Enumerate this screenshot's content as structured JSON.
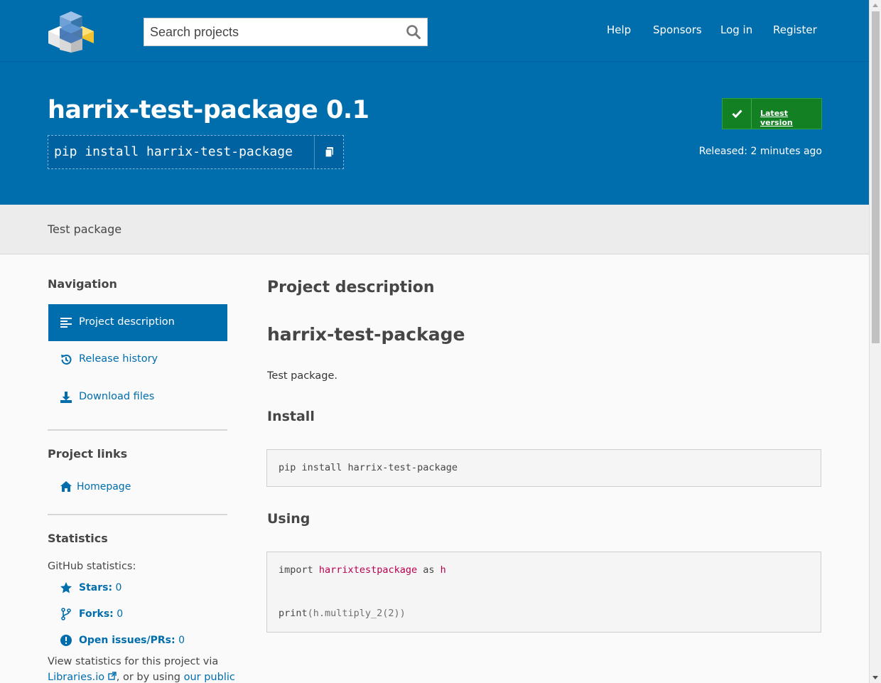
{
  "header": {
    "search_placeholder": "Search projects",
    "nav": [
      "Help",
      "Sponsors",
      "Log in",
      "Register"
    ]
  },
  "banner": {
    "title": "harrix-test-package 0.1",
    "pip_command": "pip install harrix-test-package",
    "latest_version_label": "Latest version",
    "released_label": "Released:",
    "released_value": "2 minutes ago"
  },
  "summary": "Test package",
  "sidebar": {
    "navigation_heading": "Navigation",
    "nav_items": [
      {
        "label": "Project description",
        "icon": "align-left-icon",
        "active": true
      },
      {
        "label": "Release history",
        "icon": "history-icon",
        "active": false
      },
      {
        "label": "Download files",
        "icon": "download-icon",
        "active": false
      }
    ],
    "links_heading": "Project links",
    "homepage_label": "Homepage",
    "statistics_heading": "Statistics",
    "github_stats_label": "GitHub statistics:",
    "stars_label": "Stars:",
    "stars_value": "0",
    "forks_label": "Forks:",
    "forks_value": "0",
    "issues_label": "Open issues/PRs:",
    "issues_value": "0",
    "view_stats_text": "View statistics for this project via",
    "libraries_link": "Libraries.io",
    "or_text": ", or by using",
    "our_public_link": "our public"
  },
  "main": {
    "section_heading": "Project description",
    "readme_title": "harrix-test-package",
    "readme_text": "Test package.",
    "install_heading": "Install",
    "install_code": "pip install harrix-test-package",
    "using_heading": "Using",
    "code_line1": {
      "kw": "import",
      "name": "harrixtestpackage",
      "as": "as",
      "alias": "h"
    },
    "code_line2": {
      "fn": "print",
      "rest": "(h.multiply_2(2))"
    }
  },
  "colors": {
    "brand_blue": "#006dad",
    "green": "#148024",
    "summary_bg": "#ececec"
  }
}
